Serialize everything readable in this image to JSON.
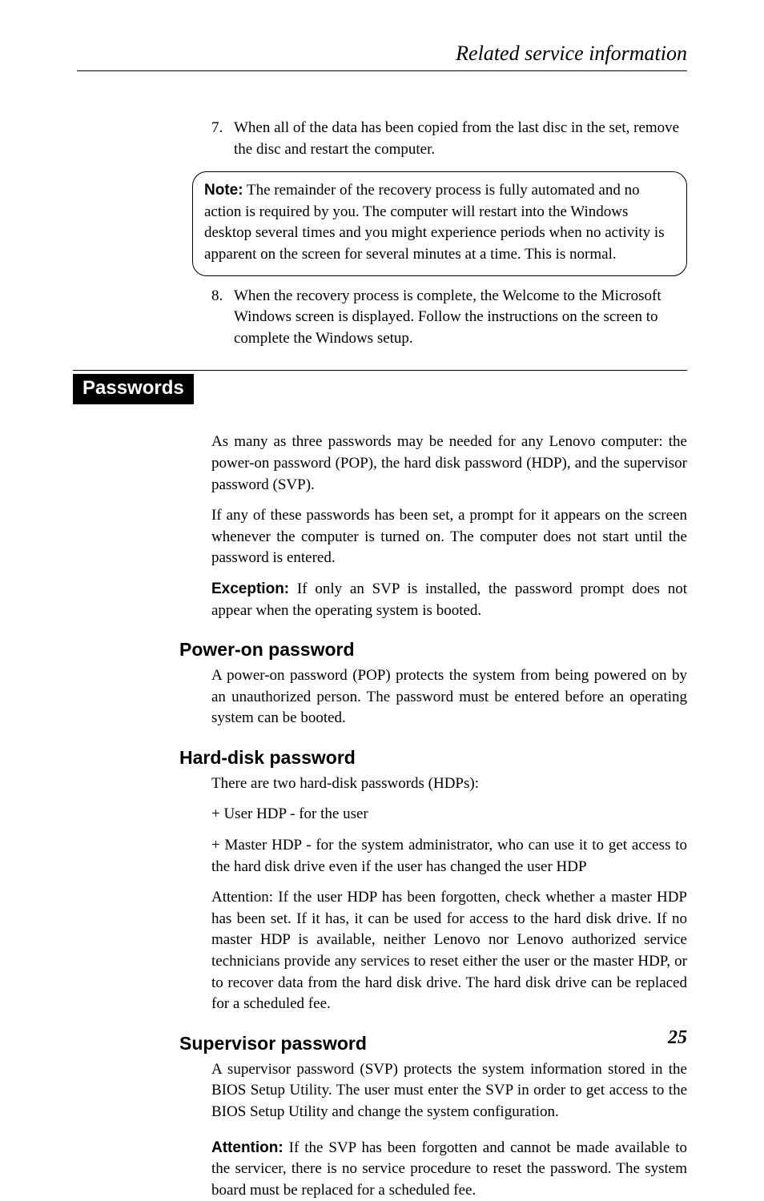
{
  "running_head": "Related service information",
  "step7": {
    "num": "7.",
    "text": "When all of the data has been copied from the last disc in the set, remove the disc and restart the computer."
  },
  "note": {
    "lead": "Note:",
    "text": " The remainder of the recovery process is fully automated and no action is required by you. The computer will restart into the Windows desktop several times and you might experience periods when no activity is apparent on the screen for several minutes at a time. This is normal."
  },
  "step8": {
    "num": "8.",
    "text": "When the recovery process is complete, the Welcome to the Microsoft Windows screen is displayed. Follow the instructions on the screen to complete the Windows setup."
  },
  "passwords": {
    "title": "Passwords",
    "intro1": "As many as three passwords may be needed for any Lenovo computer: the power-on password (POP), the hard disk password (HDP), and the supervisor password (SVP).",
    "intro2": "If any of these passwords has been set, a prompt for it appears on the screen whenever the computer is turned on. The computer does not start until the password is entered.",
    "exception_lead": "Exception:",
    "exception_text": " If only an SVP is installed, the password prompt does not appear when the operating system is booted."
  },
  "pop": {
    "title": "Power-on password",
    "text": "A power-on password (POP) protects the system from being powered on by an unauthorized person. The password must be entered before an operating system can be booted."
  },
  "hdp": {
    "title": "Hard-disk password",
    "line1": "There are two hard-disk passwords (HDPs):",
    "line2": "+ User HDP - for the user",
    "line3": "+ Master HDP - for the system administrator, who can use it to get access to the hard disk drive even if the user has changed the user HDP",
    "line4": "Attention: If the user HDP has been forgotten, check whether a master HDP has been set. If it has, it can be used for access to the hard disk drive. If no master HDP is available, neither Lenovo nor Lenovo authorized service technicians provide any services to reset either the user or the master HDP, or to recover data from the hard disk drive. The hard disk drive can be replaced for a scheduled fee."
  },
  "svp": {
    "title": "Supervisor password",
    "text1": "A supervisor password (SVP) protects the system information stored in the BIOS Setup Utility. The user must enter the SVP in order to get access to the BIOS Setup Utility and change the system configuration.",
    "attention_lead": "Attention:",
    "attention_text": " If the SVP has been forgotten and cannot be made available to the servicer, there is no service procedure to reset the password. The system board must be replaced for a scheduled fee."
  },
  "page_number": "25"
}
